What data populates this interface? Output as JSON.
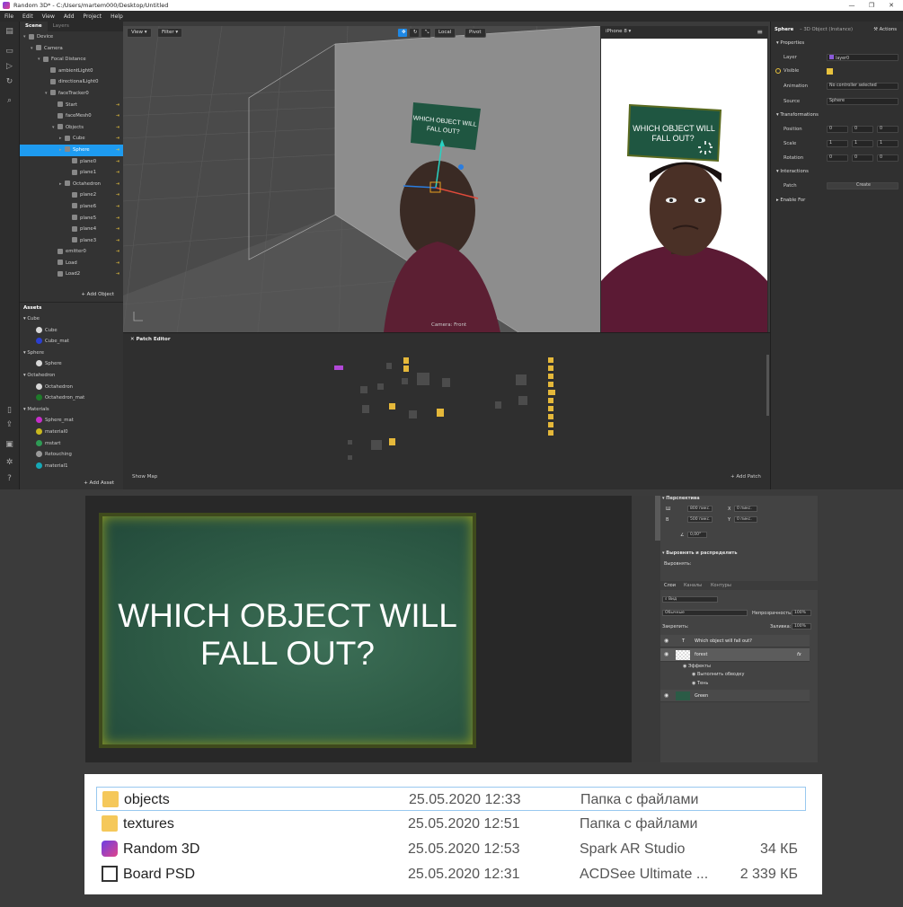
{
  "window": {
    "title": "Random 3D* - C:/Users/martem000/Desktop/Untitled"
  },
  "menu": [
    "File",
    "Edit",
    "View",
    "Add",
    "Project",
    "Help"
  ],
  "scene_panel": {
    "tabs": [
      "Scene",
      "Layers"
    ],
    "tree": [
      {
        "label": "Device",
        "indent": 0,
        "arrow": "▾"
      },
      {
        "label": "Camera",
        "indent": 1,
        "arrow": "▾"
      },
      {
        "label": "Focal Distance",
        "indent": 2,
        "arrow": "▾"
      },
      {
        "label": "ambientLight0",
        "indent": 3,
        "arrow": ""
      },
      {
        "label": "directionalLight0",
        "indent": 3,
        "arrow": ""
      },
      {
        "label": "faceTracker0",
        "indent": 3,
        "arrow": "▾"
      },
      {
        "label": "Start",
        "indent": 4,
        "arrow": ""
      },
      {
        "label": "faceMesh0",
        "indent": 4,
        "arrow": ""
      },
      {
        "label": "Objects",
        "indent": 4,
        "arrow": "▾"
      },
      {
        "label": "Cube",
        "indent": 5,
        "arrow": "▸"
      },
      {
        "label": "Sphere",
        "indent": 5,
        "arrow": "▸",
        "selected": true
      },
      {
        "label": "plane0",
        "indent": 6,
        "arrow": ""
      },
      {
        "label": "plane1",
        "indent": 6,
        "arrow": ""
      },
      {
        "label": "Octahedron",
        "indent": 5,
        "arrow": "▸"
      },
      {
        "label": "plane2",
        "indent": 6,
        "arrow": ""
      },
      {
        "label": "plane6",
        "indent": 6,
        "arrow": ""
      },
      {
        "label": "plane5",
        "indent": 6,
        "arrow": ""
      },
      {
        "label": "plane4",
        "indent": 6,
        "arrow": ""
      },
      {
        "label": "plane3",
        "indent": 6,
        "arrow": ""
      },
      {
        "label": "emitter0",
        "indent": 4,
        "arrow": ""
      },
      {
        "label": "Load",
        "indent": 4,
        "arrow": ""
      },
      {
        "label": "Load2",
        "indent": 4,
        "arrow": ""
      }
    ],
    "add_object": "+ Add Object"
  },
  "assets_panel": {
    "title": "Assets",
    "rows": [
      {
        "label": "Cube",
        "group": true
      },
      {
        "label": "Cube",
        "color": "#d8d8d8"
      },
      {
        "label": "Cube_mat",
        "color": "#2b3fd1"
      },
      {
        "label": "Sphere",
        "group": true
      },
      {
        "label": "Sphere",
        "color": "#d8d8d8"
      },
      {
        "label": "Octahedron",
        "group": true
      },
      {
        "label": "Octahedron",
        "color": "#d8d8d8"
      },
      {
        "label": "Octahedron_mat",
        "color": "#1f7a2a"
      },
      {
        "label": "Materials",
        "group": true
      },
      {
        "label": "Sphere_mat",
        "color": "#c62ec9"
      },
      {
        "label": "material0",
        "color": "#c9b81e"
      },
      {
        "label": "mstart",
        "color": "#2e9b55"
      },
      {
        "label": "Retouching",
        "color": "#9a9a9a"
      },
      {
        "label": "material1",
        "color": "#16a8b6"
      }
    ],
    "add_asset": "+ Add Asset"
  },
  "viewport": {
    "view_btn": "View ▾",
    "filter_btn": "Filter ▾",
    "local_btn": "Local",
    "pivot_btn": "Pivot",
    "camera_label": "Camera: Front",
    "board_text": "WHICH OBJECT WILL FALL OUT?"
  },
  "simulator": {
    "device": "iPhone 8 ▾",
    "board_text": "WHICH OBJECT WILL FALL OUT?"
  },
  "patch_editor": {
    "title": "Patch Editor",
    "show_map": "Show Map",
    "add_patch": "+ Add Patch"
  },
  "properties": {
    "object_name": "Sphere",
    "object_type": "– 3D Object (Instance)",
    "actions": "Actions",
    "properties_hd": "Properties",
    "layer_lbl": "Layer",
    "layer_val": "layer0",
    "visible_lbl": "Visible",
    "animation_lbl": "Animation",
    "animation_val": "No controller selected",
    "source_lbl": "Source",
    "source_val": "Sphere",
    "transformations_hd": "Transformations",
    "position_lbl": "Position",
    "position": [
      "0",
      "0",
      "0"
    ],
    "scale_lbl": "Scale",
    "scale": [
      "1",
      "1",
      "1"
    ],
    "rotation_lbl": "Rotation",
    "rotation": [
      "0",
      "0",
      "0"
    ],
    "interactions_hd": "Interactions",
    "patch_lbl": "Patch",
    "create_btn": "Create",
    "enable_for_hd": "Enable For"
  },
  "photoshop": {
    "board_text": "WHICH OBJECT WILL FALL OUT?",
    "perspective_hd": "Перспектива",
    "w_lbl": "Ш",
    "w_val": "800 пикс.",
    "h_lbl": "В",
    "h_val": "500 пикс.",
    "x_lbl": "X",
    "x_val": "0 пикс.",
    "y_lbl": "Y",
    "y_val": "0 пикс.",
    "angle_val": "0,00°",
    "align_hd": "Выровнять и распределить",
    "align_sub": "Выровнять:",
    "tabs": [
      "Слои",
      "Каналы",
      "Контуры"
    ],
    "kind": "Вид",
    "blend": "Обычные",
    "opacity_lbl": "Непрозрачность:",
    "opacity_val": "100%",
    "lock_lbl": "Закрепить:",
    "fill_lbl": "Заливка:",
    "fill_val": "100%",
    "layers": {
      "text_layer": "Which object will fall out?",
      "forest": "forest",
      "effects": "Эффекты",
      "stroke": "Выполнить обводку",
      "shadow": "Тень",
      "green": "Green"
    },
    "fx": "fx"
  },
  "explorer": {
    "rows": [
      {
        "name": "objects",
        "date": "25.05.2020 12:33",
        "type": "Папка с файлами",
        "size": "",
        "icon": "folder"
      },
      {
        "name": "textures",
        "date": "25.05.2020 12:51",
        "type": "Папка с файлами",
        "size": "",
        "icon": "folder"
      },
      {
        "name": "Random 3D",
        "date": "25.05.2020 12:53",
        "type": "Spark AR Studio",
        "size": "34 КБ",
        "icon": "spark-ar-file"
      },
      {
        "name": "Board PSD",
        "date": "25.05.2020 12:31",
        "type": "ACDSee Ultimate ...",
        "size": "2 339 КБ",
        "icon": "acdsee-file"
      }
    ]
  }
}
